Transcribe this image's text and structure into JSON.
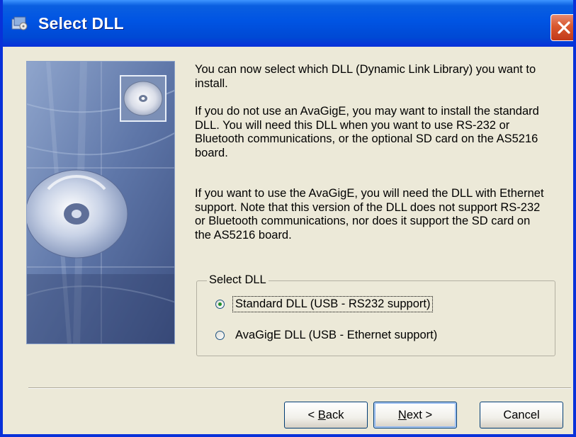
{
  "window": {
    "title": "Select DLL",
    "icon": "installer-icon",
    "close_icon": "close-icon"
  },
  "content": {
    "paragraphs": [
      "You can now select which DLL (Dynamic Link Library) you want to install.",
      "If you do not use an AvaGigE, you may want to install the standard DLL. You will need this DLL when you want to use RS-232 or Bluetooth communications, or the optional SD card on the AS5216 board.",
      "If you want to use the AvaGigE, you will need the DLL with Ethernet support. Note that this version of the DLL does not support RS-232 or Bluetooth communications, nor does it support the SD card on the AS5216 board."
    ],
    "sidebar_image": "cd-disc-graphic"
  },
  "group": {
    "legend": "Select DLL",
    "options": [
      {
        "label": "Standard DLL (USB - RS232 support)",
        "selected": true
      },
      {
        "label": "AvaGigE DLL (USB - Ethernet support)",
        "selected": false
      }
    ]
  },
  "buttons": {
    "back_prefix": "< ",
    "back_mnemonic": "B",
    "back_rest": "ack",
    "next_mnemonic": "N",
    "next_rest": "ext >",
    "cancel": "Cancel"
  },
  "colors": {
    "title_bar": "#0054e3",
    "close_button": "#d9582e",
    "background": "#ece9d8",
    "radio_dot": "#218f2a"
  }
}
